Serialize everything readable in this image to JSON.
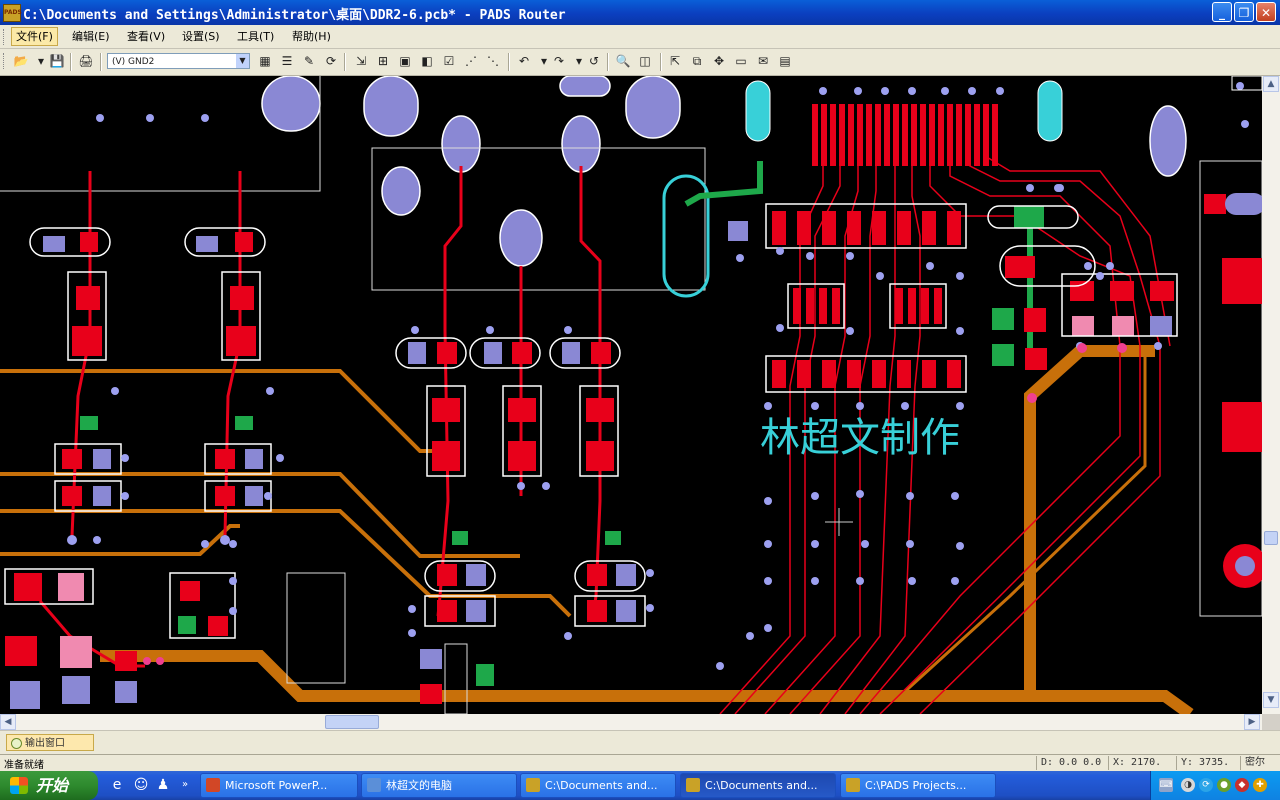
{
  "window": {
    "title": "C:\\Documents and Settings\\Administrator\\桌面\\DDR2-6.pcb* - PADS Router",
    "app_icon": "PADS"
  },
  "menu": [
    {
      "label": "文件(F)",
      "active": true
    },
    {
      "label": "编辑(E)"
    },
    {
      "label": "查看(V)"
    },
    {
      "label": "设置(S)"
    },
    {
      "label": "工具(T)"
    },
    {
      "label": "帮助(H)"
    }
  ],
  "toolbar": {
    "layer_value": "(V) GND2"
  },
  "canvas": {
    "watermark": "林超文制作",
    "theme_colors": {
      "trace": "#e8001a",
      "pad": "#8a88d4",
      "bus": "#c8700a",
      "outline": "#ffffff",
      "accent": "#38d0d8",
      "via": "#9da0f0"
    }
  },
  "output": {
    "button_label": "输出窗口"
  },
  "status": {
    "ready": "准备就绪",
    "delta": "D: 0.0 0.0",
    "x": "X: 2170.",
    "y": "Y: 3735.",
    "units": "密尔"
  },
  "taskbar": {
    "start": "开始",
    "tasks": [
      {
        "label": "Microsoft PowerP...",
        "icon": "powerpoint-icon",
        "color": "#d24726"
      },
      {
        "label": "林超文的电脑",
        "icon": "computer-icon",
        "color": "#5b8fd8"
      },
      {
        "label": "C:\\Documents and...",
        "icon": "pads-icon",
        "color": "#c9a227",
        "active": false
      },
      {
        "label": "C:\\Documents and...",
        "icon": "pads-icon",
        "color": "#c9a227",
        "active": true
      },
      {
        "label": "C:\\PADS Projects...",
        "icon": "pads-icon",
        "color": "#c9a227",
        "active": false
      }
    ]
  }
}
